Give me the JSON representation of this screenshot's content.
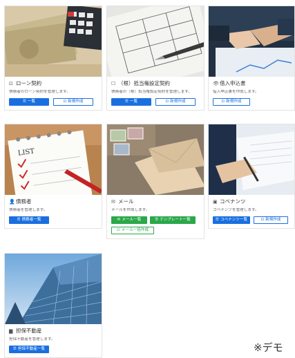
{
  "cards": [
    {
      "icon": "document-icon",
      "icon_glyph": "⊡",
      "title": "ローン契約",
      "desc": "債務者のローン契約を管理します。",
      "buttons": [
        {
          "glyph": "☰",
          "label": "一覧",
          "style": "blue"
        },
        {
          "glyph": "⊡",
          "label": "新規作成",
          "style": "outline"
        }
      ]
    },
    {
      "icon": "bookmark-icon",
      "icon_glyph": "☐",
      "title": "（根）抵当権設定契約",
      "desc": "債務者の（根）抵当権設定契約を管理します。",
      "buttons": [
        {
          "glyph": "☰",
          "label": "一覧",
          "style": "blue"
        },
        {
          "glyph": "⊡",
          "label": "新規作成",
          "style": "outline"
        }
      ]
    },
    {
      "icon": "eye-icon",
      "icon_glyph": "👁",
      "title": "借入申込書",
      "desc": "借入申込書を作成します。",
      "buttons": [
        {
          "glyph": "⊡",
          "label": "新規作成",
          "style": "outline"
        }
      ]
    },
    {
      "icon": "user-icon",
      "icon_glyph": "👤",
      "title": "債務者",
      "desc": "債務者を管理します。",
      "buttons": [
        {
          "glyph": "☰",
          "label": "債務者一覧",
          "style": "blue"
        }
      ]
    },
    {
      "icon": "mail-icon",
      "icon_glyph": "✉",
      "title": "メール",
      "desc": "メールを作成します。",
      "buttons": [
        {
          "glyph": "✉",
          "label": "メール一覧",
          "style": "green"
        },
        {
          "glyph": "☰",
          "label": "テンプレート一覧",
          "style": "green"
        },
        {
          "glyph": "☑",
          "label": "メール一括作成",
          "style": "outline-green"
        }
      ]
    },
    {
      "icon": "clipboard-icon",
      "icon_glyph": "▣",
      "title": "コベナンツ",
      "desc": "コベナンツを管理します。",
      "buttons": [
        {
          "glyph": "☰",
          "label": "コベナンツ一覧",
          "style": "blue"
        },
        {
          "glyph": "⊡",
          "label": "新規作成",
          "style": "outline"
        }
      ]
    },
    {
      "icon": "building-icon",
      "icon_glyph": "▆",
      "title": "担保不動産",
      "desc": "担保不動産を管理します。",
      "buttons": [
        {
          "glyph": "☰",
          "label": "担保不動産一覧",
          "style": "blue"
        }
      ]
    }
  ],
  "note": "※デモ"
}
